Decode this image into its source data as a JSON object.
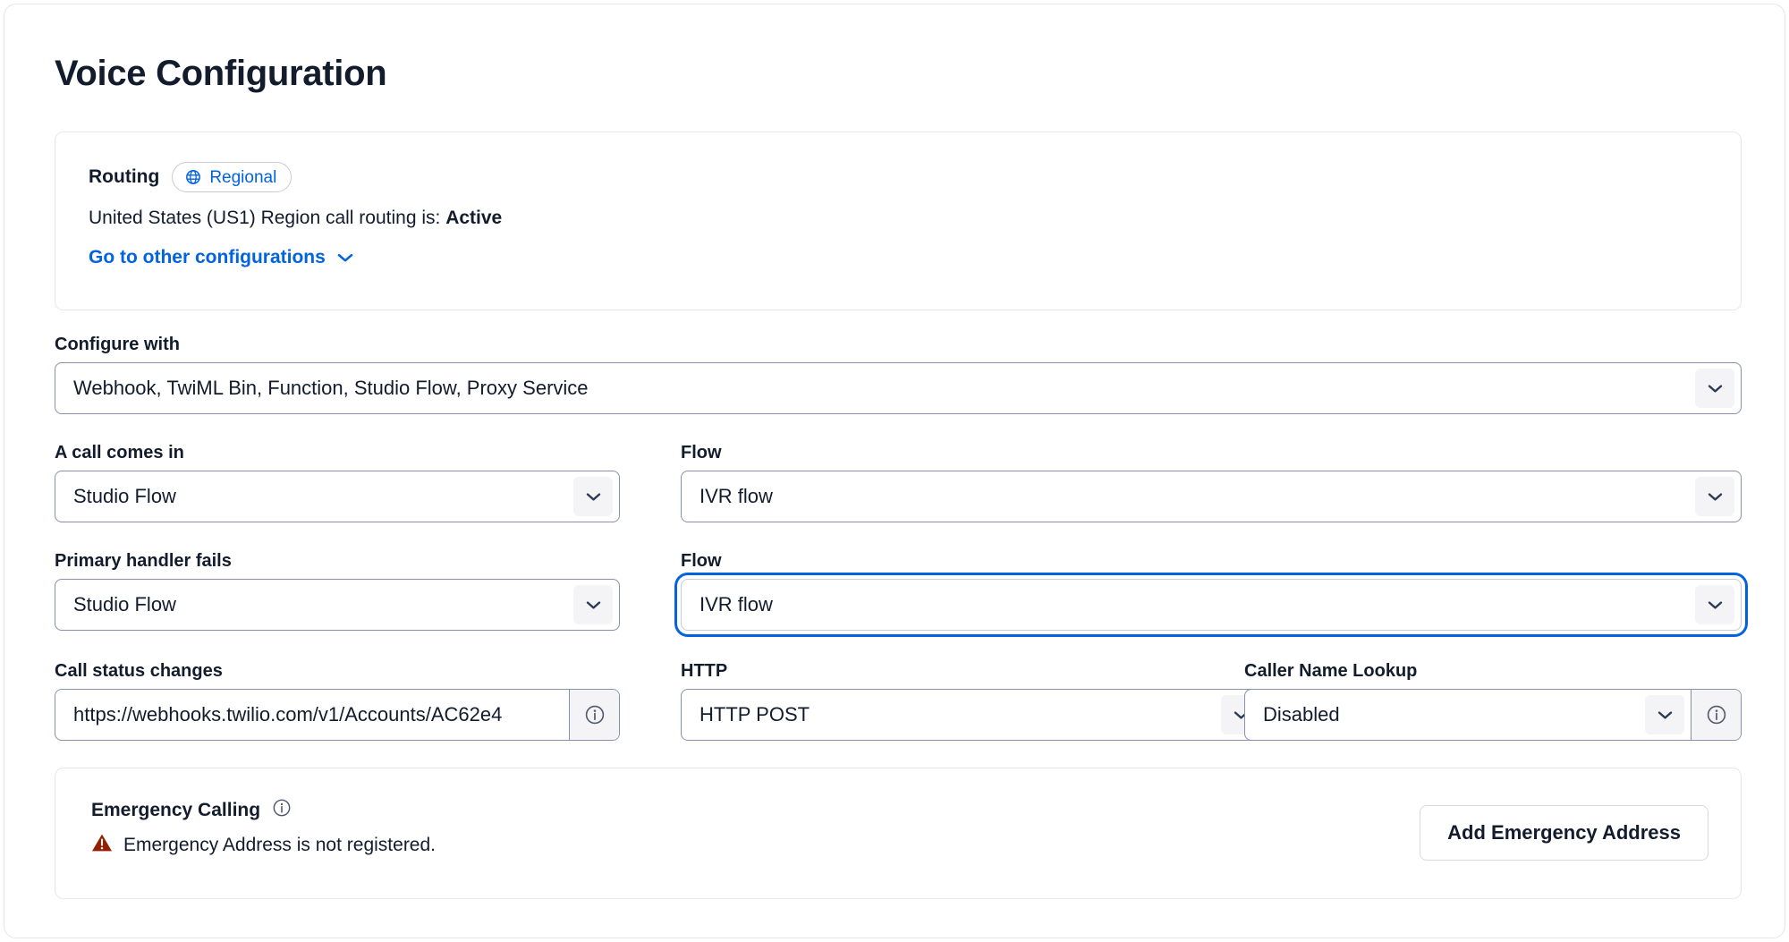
{
  "page": {
    "title": "Voice Configuration"
  },
  "routing": {
    "label": "Routing",
    "badge_text": "Regional",
    "badge_icon": "globe-icon",
    "status_prefix": "United States (US1) Region call routing is: ",
    "status_value": "Active",
    "link_text": "Go to other configurations",
    "link_icon": "chevron-down-icon"
  },
  "fields": {
    "configure_with": {
      "label": "Configure with",
      "value": "Webhook, TwiML Bin, Function, Studio Flow, Proxy Service",
      "icon": "chevron-down-icon"
    },
    "a_call_comes_in": {
      "label": "A call comes in",
      "value": "Studio Flow",
      "icon": "chevron-down-icon"
    },
    "flow_primary": {
      "label": "Flow",
      "value": "IVR flow",
      "icon": "chevron-down-icon"
    },
    "primary_handler_fails": {
      "label": "Primary handler fails",
      "value": "Studio Flow",
      "icon": "chevron-down-icon"
    },
    "flow_fallback": {
      "label": "Flow",
      "value": "IVR flow",
      "icon": "chevron-down-icon",
      "focused": true
    },
    "call_status_changes": {
      "label": "Call status changes",
      "value": "https://webhooks.twilio.com/v1/Accounts/AC62e4",
      "info_icon": "info-icon"
    },
    "http": {
      "label": "HTTP",
      "value": "HTTP POST",
      "icon": "chevron-down-icon"
    },
    "caller_name_lookup": {
      "label": "Caller Name Lookup",
      "value": "Disabled",
      "icon": "chevron-down-icon",
      "info_icon": "info-icon"
    }
  },
  "emergency": {
    "title": "Emergency Calling",
    "info_icon": "info-icon",
    "warning_icon": "warning-triangle-icon",
    "warning_text": "Emergency Address is not registered.",
    "button_label": "Add Emergency Address"
  },
  "colors": {
    "accent_blue": "#0263e0",
    "text_dark": "#121c2d",
    "border_gray": "#8891aa",
    "card_border": "#e6e7ec",
    "danger_red": "#961e00"
  }
}
